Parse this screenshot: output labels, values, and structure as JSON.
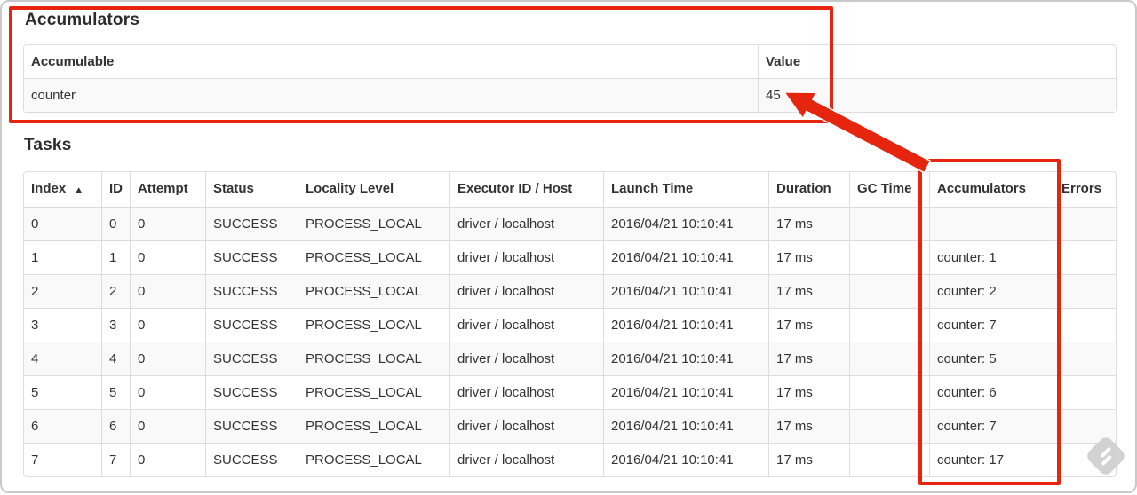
{
  "accumulators_section": {
    "title": "Accumulators",
    "table": {
      "headers": [
        "Accumulable",
        "Value"
      ],
      "rows": [
        [
          "counter",
          "45"
        ]
      ]
    }
  },
  "tasks_section": {
    "title": "Tasks",
    "table": {
      "sort_icon": "▲",
      "headers": [
        "Index",
        "ID",
        "Attempt",
        "Status",
        "Locality Level",
        "Executor ID / Host",
        "Launch Time",
        "Duration",
        "GC Time",
        "Accumulators",
        "Errors"
      ],
      "rows": [
        [
          "0",
          "0",
          "0",
          "SUCCESS",
          "PROCESS_LOCAL",
          "driver / localhost",
          "2016/04/21 10:10:41",
          "17 ms",
          "",
          "",
          ""
        ],
        [
          "1",
          "1",
          "0",
          "SUCCESS",
          "PROCESS_LOCAL",
          "driver / localhost",
          "2016/04/21 10:10:41",
          "17 ms",
          "",
          "counter: 1",
          ""
        ],
        [
          "2",
          "2",
          "0",
          "SUCCESS",
          "PROCESS_LOCAL",
          "driver / localhost",
          "2016/04/21 10:10:41",
          "17 ms",
          "",
          "counter: 2",
          ""
        ],
        [
          "3",
          "3",
          "0",
          "SUCCESS",
          "PROCESS_LOCAL",
          "driver / localhost",
          "2016/04/21 10:10:41",
          "17 ms",
          "",
          "counter: 7",
          ""
        ],
        [
          "4",
          "4",
          "0",
          "SUCCESS",
          "PROCESS_LOCAL",
          "driver / localhost",
          "2016/04/21 10:10:41",
          "17 ms",
          "",
          "counter: 5",
          ""
        ],
        [
          "5",
          "5",
          "0",
          "SUCCESS",
          "PROCESS_LOCAL",
          "driver / localhost",
          "2016/04/21 10:10:41",
          "17 ms",
          "",
          "counter: 6",
          ""
        ],
        [
          "6",
          "6",
          "0",
          "SUCCESS",
          "PROCESS_LOCAL",
          "driver / localhost",
          "2016/04/21 10:10:41",
          "17 ms",
          "",
          "counter: 7",
          ""
        ],
        [
          "7",
          "7",
          "0",
          "SUCCESS",
          "PROCESS_LOCAL",
          "driver / localhost",
          "2016/04/21 10:10:41",
          "17 ms",
          "",
          "counter: 17",
          ""
        ]
      ]
    }
  },
  "annotation": {
    "color": "#e6250e"
  }
}
